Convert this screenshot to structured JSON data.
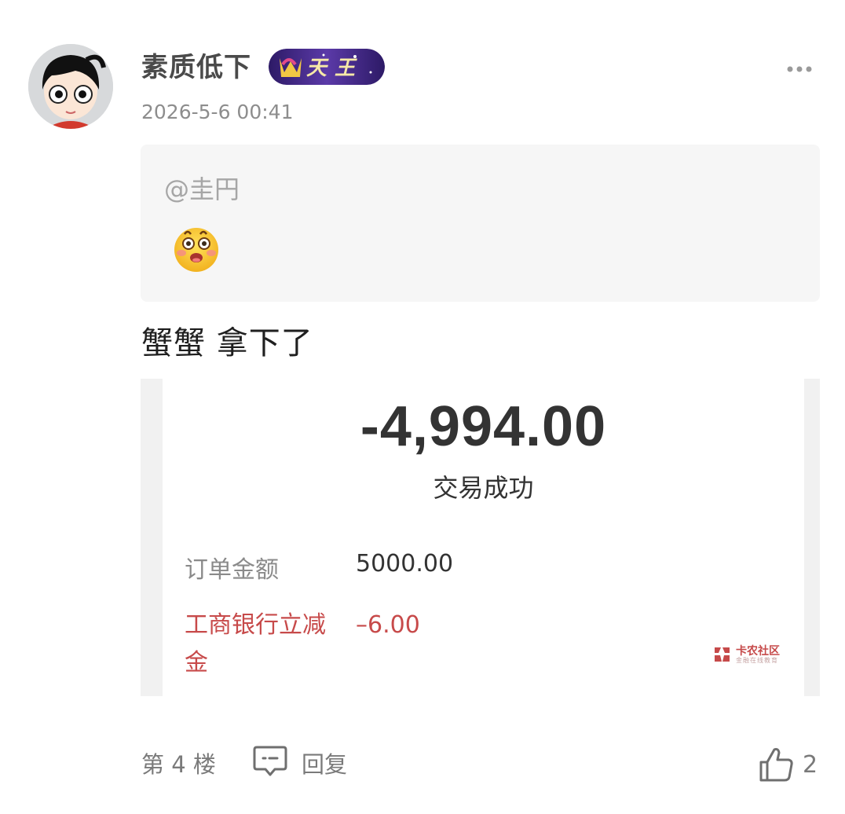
{
  "post": {
    "username": "素质低下",
    "badge_label": "天王",
    "timestamp": "2026-5-6 00:41",
    "quote": {
      "mention": "@圭円",
      "emoji": "flushed-face-icon"
    },
    "text": "蟹蟹 拿下了",
    "receipt": {
      "amount": "-4,994.00",
      "status": "交易成功",
      "order_label": "订单金额",
      "order_value": "5000.00",
      "discount_label": "工商银行立减金",
      "discount_value": "–6.00",
      "watermark_title": "卡农社区",
      "watermark_sub": "金融在线教育"
    },
    "floor": "第 4 楼",
    "reply_label": "回复",
    "like_count": "2"
  },
  "colors": {
    "accent_red": "#c74a4a",
    "badge_purple": "#4b2a86",
    "quote_bg": "#f6f6f6"
  },
  "icons": [
    "more-icon",
    "reply-icon",
    "like-icon",
    "flushed-face-icon"
  ]
}
